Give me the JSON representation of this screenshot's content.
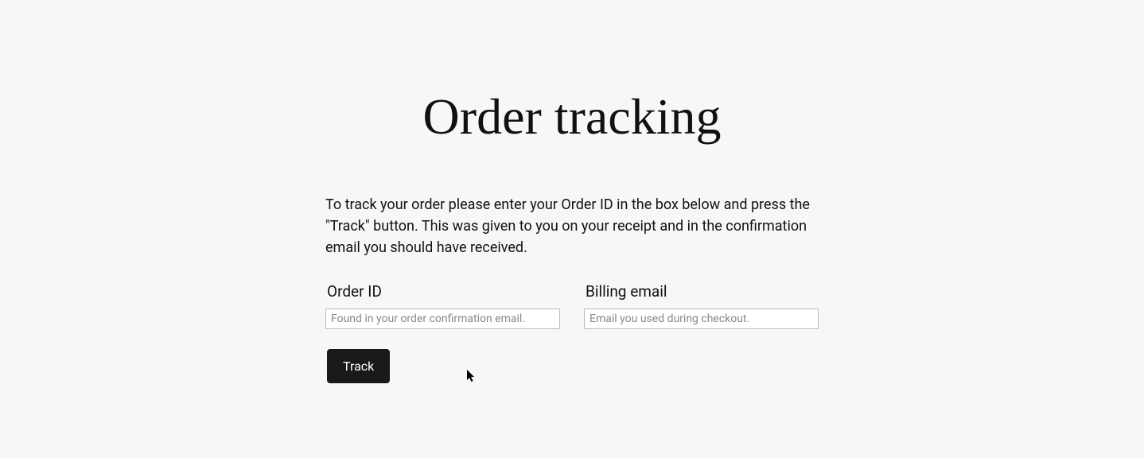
{
  "page": {
    "title": "Order tracking",
    "description": "To track your order please enter your Order ID in the box below and press the \"Track\" button. This was given to you on your receipt and in the confirmation email you should have received."
  },
  "form": {
    "order_id": {
      "label": "Order ID",
      "placeholder": "Found in your order confirmation email.",
      "value": ""
    },
    "billing_email": {
      "label": "Billing email",
      "placeholder": "Email you used during checkout.",
      "value": ""
    },
    "submit_label": "Track"
  }
}
